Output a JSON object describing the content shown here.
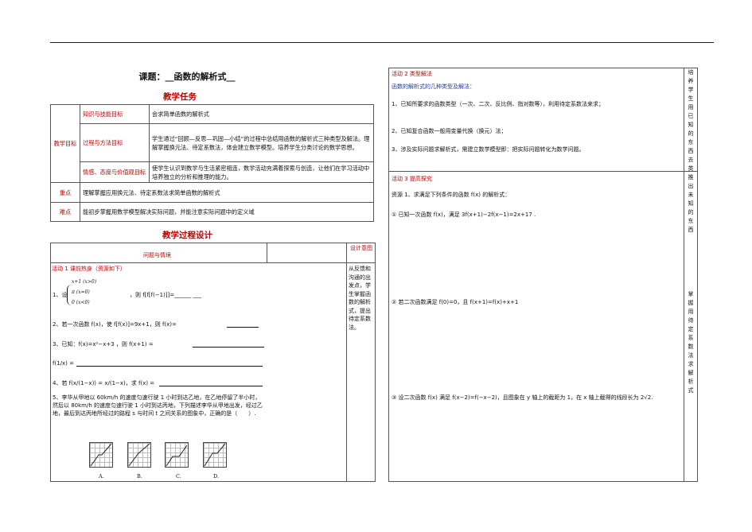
{
  "lesson_title": "课题：__函数的解析式__",
  "section_tasks": "教学任务",
  "tasks_table": {
    "goal_head": "教学目标",
    "rows": [
      {
        "label": "知识与技能目标",
        "content": "会求简单函数的解析式"
      },
      {
        "label": "过程与方法目标",
        "content": "学生通过“回顾—反思—巩固—小结”的过程中总结用函数的解析式三种类型及解法。理解掌握换元法、待定系数法，体会建立数学模型。培养学生分类讨论的数学思想。"
      },
      {
        "label": "情感、态度与价值观目标",
        "content": "使学生认识到数学与生活紧密相连，数学活动充满着探索与创造，让他们在学习活动中培养独立的分析和推理的能力。"
      }
    ],
    "key_label": "重点",
    "key_content": "理解掌握应用换元法、待定系数法求简单函数的解析式",
    "diff_label": "难点",
    "diff_content": "能初步掌握用数学模型解决实际问题，并能注意实际问题中的定义域"
  },
  "section_process": "教学过程设计",
  "process_table": {
    "col1_head": "问题与情境",
    "col3_head": "设计意图",
    "activity1_title": "活动 1 课前热身（资源如下）",
    "q1_prefix": "1、设",
    "q1_cases": [
      "x+1 (x>0)",
      "π (x=0)",
      "0 (x<0)"
    ],
    "q1_tail": "，则 f[f[f(−1)]]=______ ___",
    "q2": "2、若一次函数 f(x)，使 f[f(x)]=9x+1，则 f(x)=",
    "q3": "3、已知：f(x)=x²−x+3 ，则 f(x+1) =",
    "q3b": "f(1/x) =",
    "q4": "4、若 f(x/(1−x)) = x/(1−x)，求 f(x) =",
    "q5": "5、李华从甲地以 60km/h 的速度匀速行驶 1 小时到达乙地，在乙地停留了半小时，然后以 80km/h 的速度匀速行驶 1 小时到达丙地，下列描述李华从甲地出发，经过乙地，最后到达丙地所经过的路程 s 与时间 t 之间关系的图象中，正确的是（　　）.",
    "graph_labels": [
      "A.",
      "B.",
      "C.",
      "D."
    ],
    "intent1": "从反馈和沟通的出发点，学生掌握函数的解析式，提出待定系数法。"
  },
  "right_table": {
    "activity2_title": "活动 2 类型解法",
    "activity2_sub": "函数的解析式的几种类型及解法：",
    "activity2_items": [
      "1、已知所要求的函数类型（一次、二次、反比例、指对数等），利用待定系数法来求；",
      "2、已知复合函数一般用变量代换（换元）法；",
      "3、涉及实际问题求解析式，需建立数学模型即：把实际问题转化为数学问题。"
    ],
    "intent2": "培养学生用已知的东西去类推出未知的东西",
    "activity3_title": "活动 3 提高探究",
    "activity3_sub": "资源 1、求满足下列条件的函数 f(x) 的解析式：",
    "p1": "① 已知一次函数 f(x)，满足 3f(x+1)−2f(x−1)=2x+17 .",
    "p2": "② 若二次函数满足 f(0)=0，且 f(x+1)=f(x)+x+1",
    "p3": "③ 设二次函数 f(x) 满足 f(x−2)=f(−x−2)，且图象在 y 轴上的截距为 1，在 x 轴上截得的线段长为 2√2.",
    "intent3": "掌握用待定系数法求解析式"
  }
}
